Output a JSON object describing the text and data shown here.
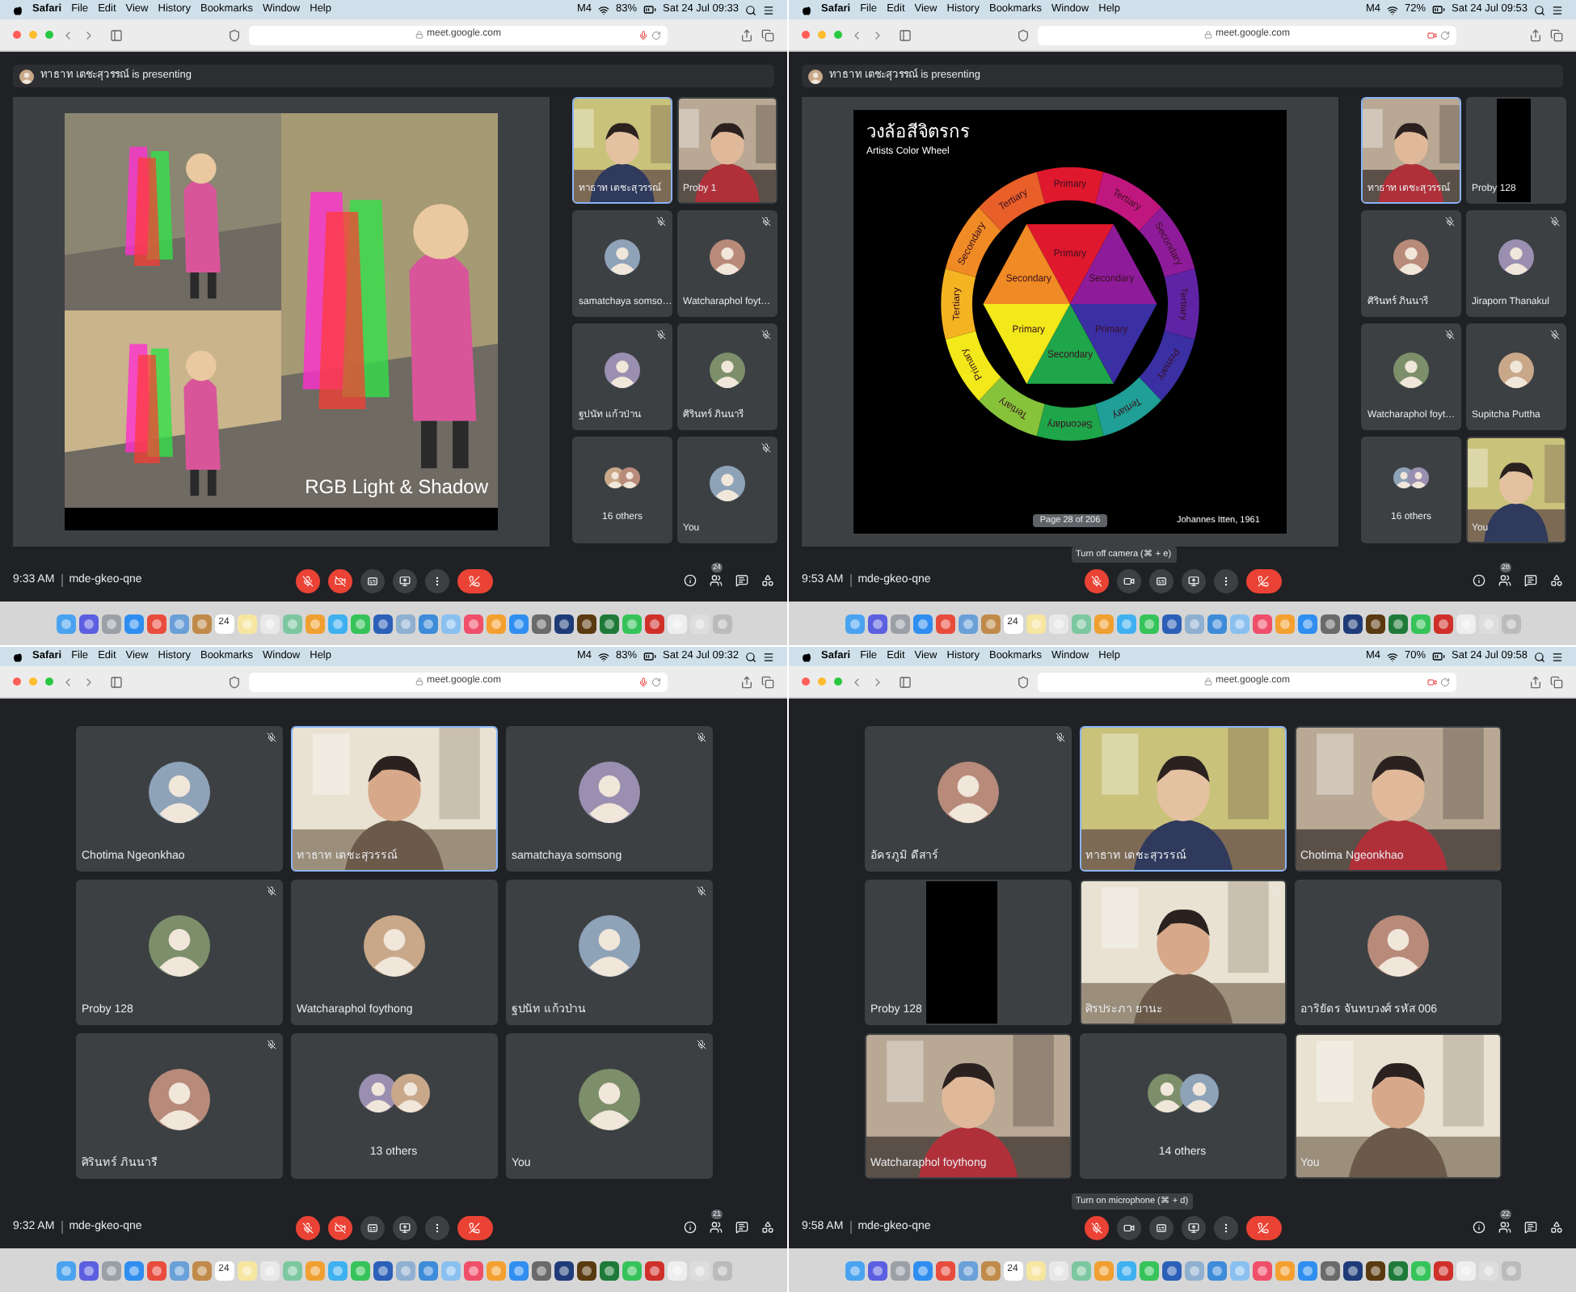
{
  "panels": [
    {
      "menubar": {
        "app": "Safari",
        "menus": [
          "File",
          "Edit",
          "View",
          "History",
          "Bookmarks",
          "Window",
          "Help"
        ],
        "status": "M4",
        "battery": "83%",
        "clock": "Sat 24 Jul 09:33"
      },
      "browser": {
        "url": "meet.google.com",
        "indicator": {
          "kind": "mic"
        }
      },
      "presenting": {
        "text": "ทาธาท เตชะสุวรรณ์ is presenting"
      },
      "stage": {
        "kind": "photo_slide",
        "title": "RGB Light & Shadow"
      },
      "tiles": [
        {
          "kind": "video",
          "name": "ทาธาท เตชะสุวรรณ์",
          "selected": true,
          "muted": false
        },
        {
          "kind": "video",
          "name": "Proby 1",
          "selected": false,
          "muted": false
        },
        {
          "kind": "avatar",
          "name": "samatchaya somso…",
          "selected": false,
          "muted": true
        },
        {
          "kind": "avatar",
          "name": "Watcharaphol foyt…",
          "selected": false,
          "muted": true
        },
        {
          "kind": "avatar",
          "name": "ฐปนัท แก้วป่าน",
          "selected": false,
          "muted": true
        },
        {
          "kind": "avatar",
          "name": "ศิรินทร์ ภินนารี",
          "selected": false,
          "muted": true
        },
        {
          "kind": "others",
          "name": "16 others",
          "selected": false,
          "muted": false
        },
        {
          "kind": "avatar",
          "name": "You",
          "selected": false,
          "muted": true
        }
      ],
      "footer": {
        "time": "9:33 AM",
        "meeting_code": "mde-gkeo-qne",
        "mic_on": false,
        "camera_on": false,
        "people_count": "24"
      },
      "dock": {
        "calendar_day": "24"
      }
    },
    {
      "menubar": {
        "app": "Safari",
        "menus": [
          "File",
          "Edit",
          "View",
          "History",
          "Bookmarks",
          "Window",
          "Help"
        ],
        "status": "M4",
        "battery": "72%",
        "clock": "Sat 24 Jul 09:53"
      },
      "browser": {
        "url": "meet.google.com",
        "indicator": {
          "kind": "camera"
        }
      },
      "presenting": {
        "text": "ทาธาท เตชะสุวรรณ์ is presenting"
      },
      "stage": {
        "kind": "wheel_slide",
        "title": "วงล้อสีจิตรกร",
        "subtitle": "Artists Color Wheel",
        "page": "Page 28 of 206",
        "credit": "Johannes Itten, 1961",
        "ring": [
          {
            "label": "Primary",
            "color": "#e0182d"
          },
          {
            "label": "Tertiary",
            "color": "#c0177e"
          },
          {
            "label": "Secondary",
            "color": "#8e1c9a"
          },
          {
            "label": "Tertiary",
            "color": "#5f24a6"
          },
          {
            "label": "Primary",
            "color": "#3a2fa3"
          },
          {
            "label": "Tertiary",
            "color": "#1f9f95"
          },
          {
            "label": "Secondary",
            "color": "#1fa54a"
          },
          {
            "label": "Tertiary",
            "color": "#86c33a"
          },
          {
            "label": "Primary",
            "color": "#f2e81a"
          },
          {
            "label": "Tertiary",
            "color": "#f4b422"
          },
          {
            "label": "Secondary",
            "color": "#f08a24"
          },
          {
            "label": "Tertiary",
            "color": "#e85f2a"
          }
        ],
        "center": [
          {
            "label": "Primary",
            "color": "#e0182d"
          },
          {
            "label": "Secondary",
            "color": "#8e1c9a"
          },
          {
            "label": "Primary",
            "color": "#3a2fa3"
          },
          {
            "label": "Secondary",
            "color": "#1fa54a"
          },
          {
            "label": "Primary",
            "color": "#f2e81a"
          },
          {
            "label": "Secondary",
            "color": "#f08a24"
          }
        ]
      },
      "tiles": [
        {
          "kind": "video",
          "name": "ทาธาท เตชะสุวรรณ์",
          "selected": true,
          "muted": false
        },
        {
          "kind": "black",
          "name": "Proby 128",
          "selected": false,
          "muted": false
        },
        {
          "kind": "avatar",
          "name": "ศิรินทร์ ภินนารี",
          "selected": false,
          "muted": true
        },
        {
          "kind": "avatar",
          "name": "Jiraporn Thanakul",
          "selected": false,
          "muted": true
        },
        {
          "kind": "avatar",
          "name": "Watcharaphol foyt…",
          "selected": false,
          "muted": true
        },
        {
          "kind": "avatar",
          "name": "Supitcha Puttha",
          "selected": false,
          "muted": true
        },
        {
          "kind": "others",
          "name": "16 others",
          "selected": false,
          "muted": false
        },
        {
          "kind": "video",
          "name": "You",
          "selected": false,
          "muted": false
        }
      ],
      "tooltip": "Turn off camera (⌘ + e)",
      "footer": {
        "time": "9:53 AM",
        "meeting_code": "mde-gkeo-qne",
        "mic_on": false,
        "camera_on": true,
        "people_count": "28"
      },
      "dock": {
        "calendar_day": "24"
      }
    },
    {
      "menubar": {
        "app": "Safari",
        "menus": [
          "File",
          "Edit",
          "View",
          "History",
          "Bookmarks",
          "Window",
          "Help"
        ],
        "status": "M4",
        "battery": "83%",
        "clock": "Sat 24 Jul 09:32"
      },
      "browser": {
        "url": "meet.google.com",
        "indicator": {
          "kind": "mic"
        }
      },
      "tiles": [
        {
          "kind": "avatar",
          "name": "Chotima Ngeonkhao",
          "selected": false,
          "muted": true
        },
        {
          "kind": "video",
          "name": "ทาธาท เตชะสุวรรณ์",
          "selected": true,
          "muted": false
        },
        {
          "kind": "avatar",
          "name": "samatchaya somsong",
          "selected": false,
          "muted": true
        },
        {
          "kind": "avatar",
          "name": "Proby 128",
          "selected": false,
          "muted": true
        },
        {
          "kind": "avatar",
          "name": "Watcharaphol foythong",
          "selected": false,
          "muted": false
        },
        {
          "kind": "avatar",
          "name": "ฐปนัท แก้วป่าน",
          "selected": false,
          "muted": true
        },
        {
          "kind": "avatar",
          "name": "ศิรินทร์ ภินนารี",
          "selected": false,
          "muted": true
        },
        {
          "kind": "others",
          "name": "13 others",
          "selected": false,
          "muted": false
        },
        {
          "kind": "avatar",
          "name": "You",
          "selected": false,
          "muted": true
        }
      ],
      "footer": {
        "time": "9:32 AM",
        "meeting_code": "mde-gkeo-qne",
        "mic_on": false,
        "camera_on": false,
        "people_count": "21"
      },
      "dock": {
        "calendar_day": "24"
      }
    },
    {
      "menubar": {
        "app": "Safari",
        "menus": [
          "File",
          "Edit",
          "View",
          "History",
          "Bookmarks",
          "Window",
          "Help"
        ],
        "status": "M4",
        "battery": "70%",
        "clock": "Sat 24 Jul 09:58"
      },
      "browser": {
        "url": "meet.google.com",
        "indicator": {
          "kind": "camera"
        }
      },
      "tiles": [
        {
          "kind": "avatar",
          "name": "อัครภูมิ ดีสาร์",
          "selected": false,
          "muted": true
        },
        {
          "kind": "video",
          "name": "ทาธาท เตชะสุวรรณ์",
          "selected": true,
          "muted": false
        },
        {
          "kind": "video",
          "name": "Chotima Ngeonkhao",
          "selected": false,
          "muted": false
        },
        {
          "kind": "black",
          "name": "Proby 128",
          "selected": false,
          "muted": false
        },
        {
          "kind": "video",
          "name": "ศิรประภา ยานะ",
          "selected": false,
          "muted": true
        },
        {
          "kind": "avatar",
          "name": "อาริยัตร จันทบวงศ์ รหัส 006",
          "selected": false,
          "muted": false
        },
        {
          "kind": "video",
          "name": "Watcharaphol foythong",
          "selected": false,
          "muted": false
        },
        {
          "kind": "others",
          "name": "14 others",
          "selected": false,
          "muted": false
        },
        {
          "kind": "video",
          "name": "You",
          "selected": false,
          "muted": false
        }
      ],
      "tooltip": "Turn on microphone (⌘ + d)",
      "footer": {
        "time": "9:58 AM",
        "meeting_code": "mde-gkeo-qne",
        "mic_on": false,
        "camera_on": true,
        "people_count": "22"
      },
      "dock": {
        "calendar_day": "24"
      }
    }
  ]
}
